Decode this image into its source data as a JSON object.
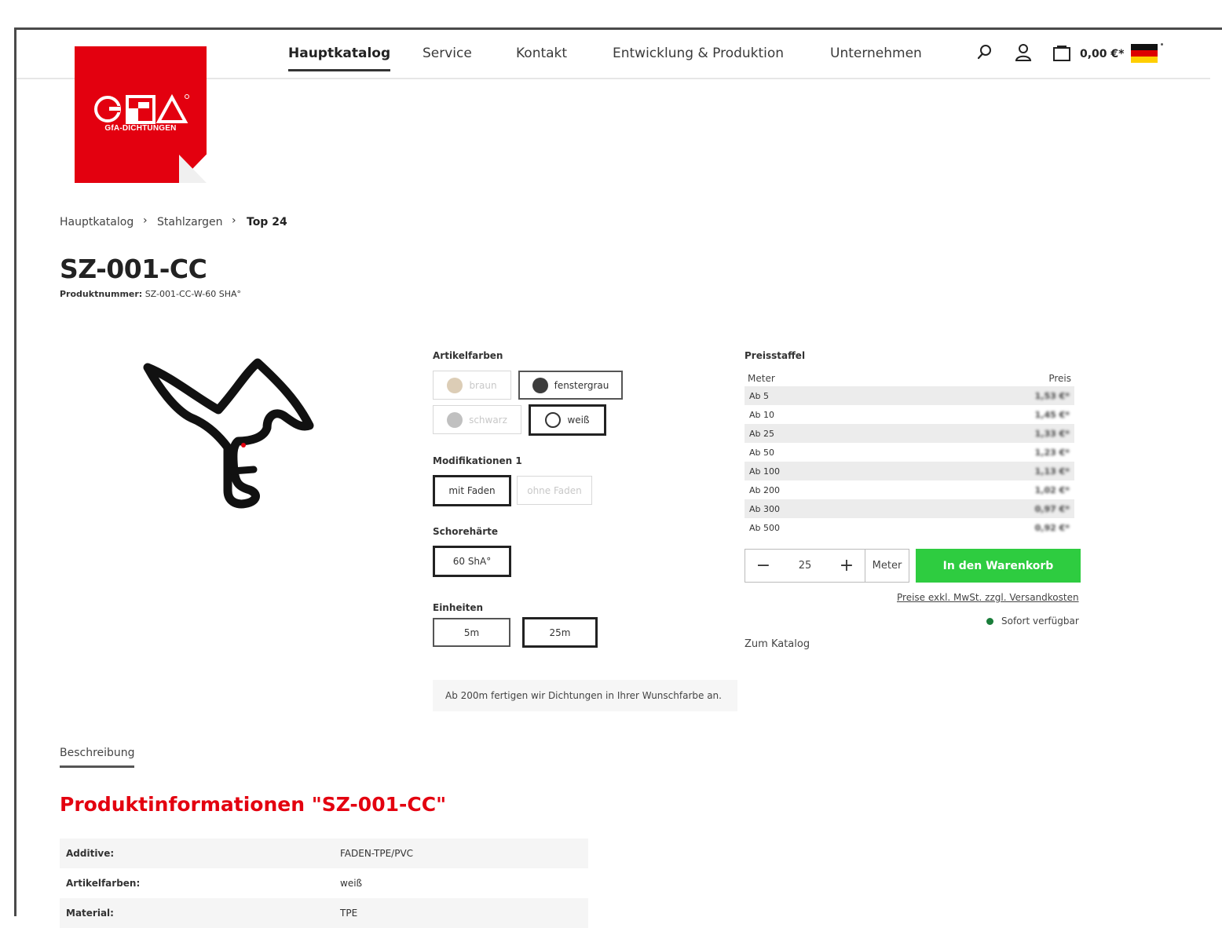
{
  "brand": {
    "name": "GfA-DICHTUNGEN",
    "accent_color": "#e3000f"
  },
  "nav": {
    "items": [
      "Hauptkatalog",
      "Service",
      "Kontakt",
      "Entwicklung & Produktion",
      "Unternehmen"
    ],
    "active": "Hauptkatalog"
  },
  "header": {
    "icons": [
      "search-icon",
      "user-icon",
      "cart-icon"
    ],
    "cart_total": "0,00 €*",
    "language": "flag-germany-icon"
  },
  "breadcrumb": [
    "Hauptkatalog",
    "Stahlzargen",
    "Top 24"
  ],
  "product": {
    "title": "SZ-001-CC",
    "number_label": "Produktnummer:",
    "number_value": "SZ-001-CC-W-60 SHA°"
  },
  "options": {
    "colors_label": "Artikelfarben",
    "colors": [
      {
        "name": "braun",
        "swatch": "#d9cbb4",
        "state": "disabled"
      },
      {
        "name": "fenstergrau",
        "swatch": "#444444",
        "state": "enabled"
      },
      {
        "name": "schwarz",
        "swatch": "#bdbdbd",
        "state": "disabled"
      },
      {
        "name": "weiß",
        "swatch": "#ffffff",
        "state": "selected"
      }
    ],
    "mods_label": "Modifikationen 1",
    "mods": [
      {
        "name": "mit Faden",
        "state": "selected"
      },
      {
        "name": "ohne Faden",
        "state": "disabled"
      }
    ],
    "hardness_label": "Schorehärte",
    "hardness": [
      {
        "name": "60 ShA°",
        "state": "selected"
      }
    ],
    "units_label": "Einheiten",
    "units": [
      {
        "name": "5m",
        "state": "enabled"
      },
      {
        "name": "25m",
        "state": "selected"
      }
    ],
    "notice": "Ab 200m fertigen wir Dichtungen in Ihrer Wunschfarbe an."
  },
  "pricing": {
    "title": "Preisstaffel",
    "col_meter": "Meter",
    "col_price": "Preis",
    "rows": [
      {
        "meter": "Ab 5",
        "price": "1,53 €*"
      },
      {
        "meter": "Ab 10",
        "price": "1,45 €*"
      },
      {
        "meter": "Ab 25",
        "price": "1,33 €*"
      },
      {
        "meter": "Ab 50",
        "price": "1,23 €*"
      },
      {
        "meter": "Ab 100",
        "price": "1,13 €*"
      },
      {
        "meter": "Ab 200",
        "price": "1,02 €*"
      },
      {
        "meter": "Ab 300",
        "price": "0,97 €*"
      },
      {
        "meter": "Ab 500",
        "price": "0,92 €*"
      }
    ],
    "quantity": "25",
    "unit": "Meter",
    "add_to_cart": "In den Warenkorb",
    "tax_note": "Preise exkl. MwSt. zzgl. Versandkosten",
    "availability": "Sofort verfügbar",
    "availability_color": "#1a7d3a",
    "back_link": "Zum Katalog",
    "cart_button_color": "#2ecc40"
  },
  "details": {
    "tab": "Beschreibung",
    "heading": "Produktinformationen \"SZ-001-CC\"",
    "attributes": [
      {
        "key": "Additive:",
        "value": "FADEN-TPE/PVC"
      },
      {
        "key": "Artikelfarben:",
        "value": "weiß"
      },
      {
        "key": "Material:",
        "value": "TPE"
      }
    ]
  }
}
